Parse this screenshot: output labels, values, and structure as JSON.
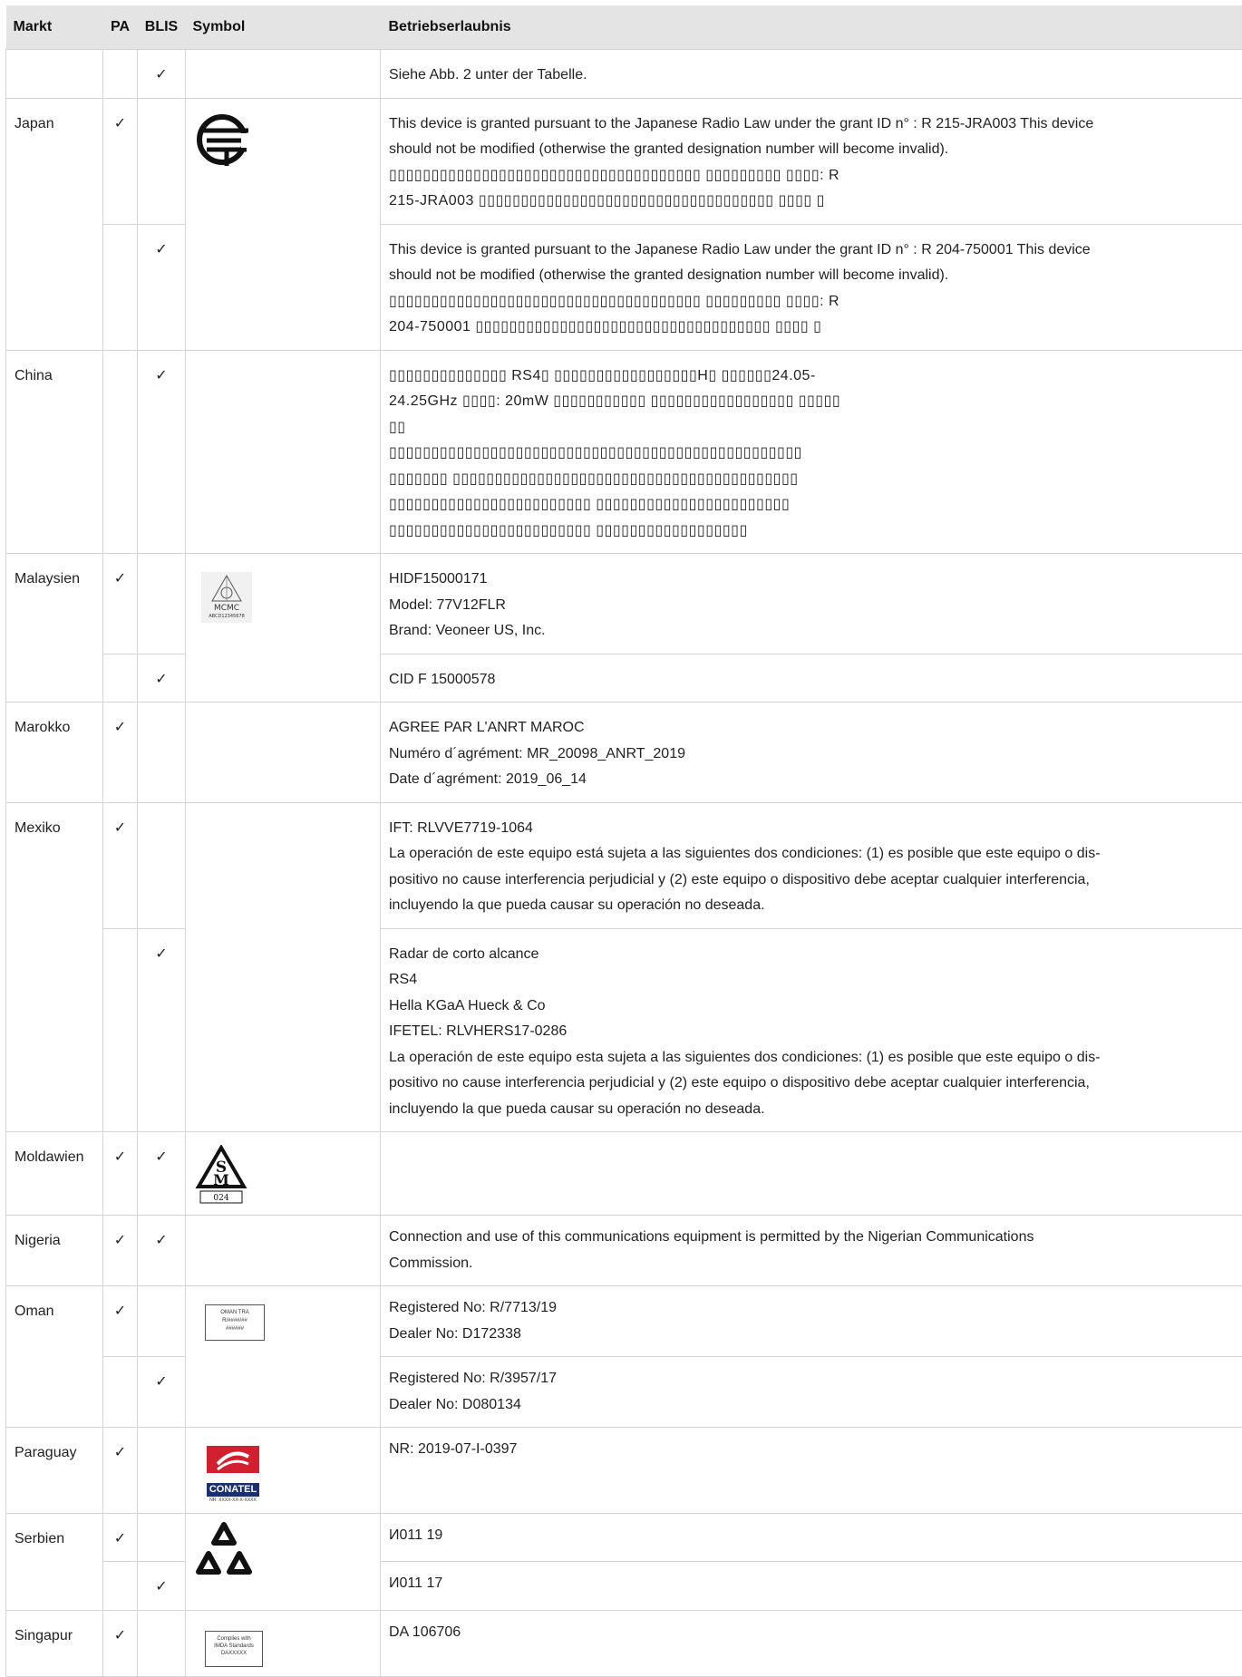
{
  "headers": {
    "market": "Markt",
    "pa": "PA",
    "blis": "BLIS",
    "symbol": "Symbol",
    "permit": "Betriebserlaubnis"
  },
  "check": "✓",
  "rows": {
    "r0": {
      "text": "Siehe Abb. 2 unter der Tabelle."
    },
    "japan": {
      "market": "Japan",
      "r1_lines": [
        "This device is granted pursuant to the Japanese Radio Law under the grant ID n° : R 215-JRA003 This device",
        "should not be modified (otherwise the granted designation number will become invalid).",
        "▯▯▯▯▯▯▯▯▯▯▯▯▯▯▯▯▯▯▯▯▯▯▯▯▯▯▯▯▯▯▯▯▯▯▯▯▯ ▯▯▯▯▯▯▯▯▯ ▯▯▯▯: R",
        "215-JRA003 ▯▯▯▯▯▯▯▯▯▯▯▯▯▯▯▯▯▯▯▯▯▯▯▯▯▯▯▯▯▯▯▯▯▯▯ ▯▯▯▯ ▯"
      ],
      "r2_lines": [
        "This device is granted pursuant to the Japanese Radio Law under the grant ID n° : R 204-750001 This device",
        "should not be modified (otherwise the granted designation number will become invalid).",
        "▯▯▯▯▯▯▯▯▯▯▯▯▯▯▯▯▯▯▯▯▯▯▯▯▯▯▯▯▯▯▯▯▯▯▯▯▯ ▯▯▯▯▯▯▯▯▯ ▯▯▯▯: R",
        "204-750001 ▯▯▯▯▯▯▯▯▯▯▯▯▯▯▯▯▯▯▯▯▯▯▯▯▯▯▯▯▯▯▯▯▯▯▯ ▯▯▯▯ ▯"
      ]
    },
    "china": {
      "market": "China",
      "lines": [
        "▯▯▯▯▯▯▯▯▯▯▯▯▯▯ RS4▯ ▯▯▯▯▯▯▯▯▯▯▯▯▯▯▯▯▯H▯ ▯▯▯▯▯▯24.05-",
        "24.25GHz ▯▯▯▯: 20mW ▯▯▯▯▯▯▯▯▯▯▯ ▯▯▯▯▯▯▯▯▯▯▯▯▯▯▯▯▯ ▯▯▯▯▯",
        "▯▯",
        "▯▯▯▯▯▯▯▯▯▯▯▯▯▯▯▯▯▯▯▯▯▯▯▯▯▯▯▯▯▯▯▯▯▯▯▯▯▯▯▯▯▯▯▯▯▯▯▯▯",
        "▯▯▯▯▯▯▯ ▯▯▯▯▯▯▯▯▯▯▯▯▯▯▯▯▯▯▯▯▯▯▯▯▯▯▯▯▯▯▯▯▯▯▯▯▯▯▯▯▯",
        "▯▯▯▯▯▯▯▯▯▯▯▯▯▯▯▯▯▯▯▯▯▯▯▯ ▯▯▯▯▯▯▯▯▯▯▯▯▯▯▯▯▯▯▯▯▯▯▯",
        "▯▯▯▯▯▯▯▯▯▯▯▯▯▯▯▯▯▯▯▯▯▯▯▯ ▯▯▯▯▯▯▯▯▯▯▯▯▯▯▯▯▯▯"
      ]
    },
    "malaysia": {
      "market": "Malaysien",
      "symbol_text": "MCMC",
      "symbol_sub": "ABCD12345678",
      "r1_lines": [
        "HIDF15000171",
        "Model: 77V12FLR",
        "Brand: Veoneer US, Inc."
      ],
      "r2_lines": [
        "CID F 15000578"
      ]
    },
    "morocco": {
      "market": "Marokko",
      "lines": [
        "AGREE PAR L'ANRT MAROC",
        "Numéro d´agrément: MR_20098_ANRT_2019",
        "Date d´agrément: 2019_06_14"
      ]
    },
    "mexico": {
      "market": "Mexiko",
      "r1_lines": [
        "IFT: RLVVE7719-1064",
        "La operación de este equipo está sujeta a las siguientes dos condiciones: (1) es posible que este equipo o dis-",
        "positivo no cause interferencia perjudicial y (2) este equipo o dispositivo debe aceptar cualquier interferencia,",
        "incluyendo la que pueda causar su operación no deseada."
      ],
      "r2_lines": [
        "Radar de corto alcance",
        "RS4",
        "Hella KGaA Hueck & Co",
        "IFETEL: RLVHERS17-0286",
        "La operación de este equipo esta sujeta a las siguientes dos condiciones: (1) es posible que este equipo o dis-",
        "positivo no cause interferencia perjudicial y (2) este equipo o dispositivo debe aceptar cualquier interferencia,",
        "incluyendo la que pueda causar su operación no deseada."
      ]
    },
    "moldova": {
      "market": "Moldawien",
      "symbol_code": "024"
    },
    "nigeria": {
      "market": "Nigeria",
      "lines": [
        "Connection and use of this communications equipment is permitted by the Nigerian Communications",
        "Commission."
      ]
    },
    "oman": {
      "market": "Oman",
      "symbol_lines": [
        "OMAN TRA",
        "R/####/##",
        "######"
      ],
      "r1_lines": [
        "Registered No: R/7713/19",
        "Dealer No: D172338"
      ],
      "r2_lines": [
        "Registered No: R/3957/17",
        "Dealer No: D080134"
      ]
    },
    "paraguay": {
      "market": "Paraguay",
      "symbol_text": "CONATEL",
      "symbol_sub": "NR: XXXX-XX-X-XXXX",
      "lines": [
        "NR: 2019-07-I-0397"
      ]
    },
    "serbia": {
      "market": "Serbien",
      "r1": "И011 19",
      "r2": "И011 17"
    },
    "singapore": {
      "market": "Singapur",
      "symbol_lines": [
        "Complies with",
        "IMDA Standards",
        "DAXXXXX"
      ],
      "lines": [
        "DA 106706"
      ]
    }
  }
}
